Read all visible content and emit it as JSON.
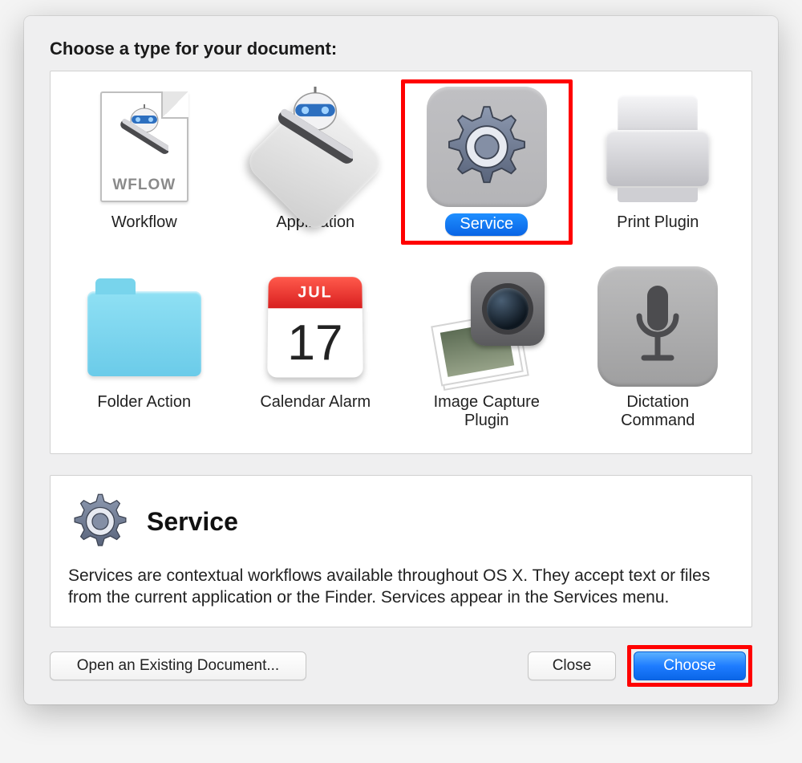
{
  "heading": "Choose a type for your document:",
  "types": [
    {
      "label": "Workflow",
      "icon": "workflow-doc-icon"
    },
    {
      "label": "Application",
      "icon": "application-robot-icon"
    },
    {
      "label": "Service",
      "icon": "gear-icon",
      "selected": true,
      "highlighted": true
    },
    {
      "label": "Print Plugin",
      "icon": "printer-icon"
    },
    {
      "label": "Folder Action",
      "icon": "folder-icon"
    },
    {
      "label": "Calendar Alarm",
      "icon": "calendar-icon",
      "calendar_month": "JUL",
      "calendar_day": "17"
    },
    {
      "label": "Image Capture Plugin",
      "icon": "camera-photos-icon"
    },
    {
      "label": "Dictation Command",
      "icon": "microphone-icon"
    }
  ],
  "info": {
    "title": "Service",
    "description": "Services are contextual workflows available throughout OS X. They accept text or files from the current application or the Finder. Services appear in the Services menu."
  },
  "buttons": {
    "open_existing": "Open an Existing Document...",
    "close": "Close",
    "choose": "Choose"
  },
  "workflow_doc_tag": "WFLOW"
}
